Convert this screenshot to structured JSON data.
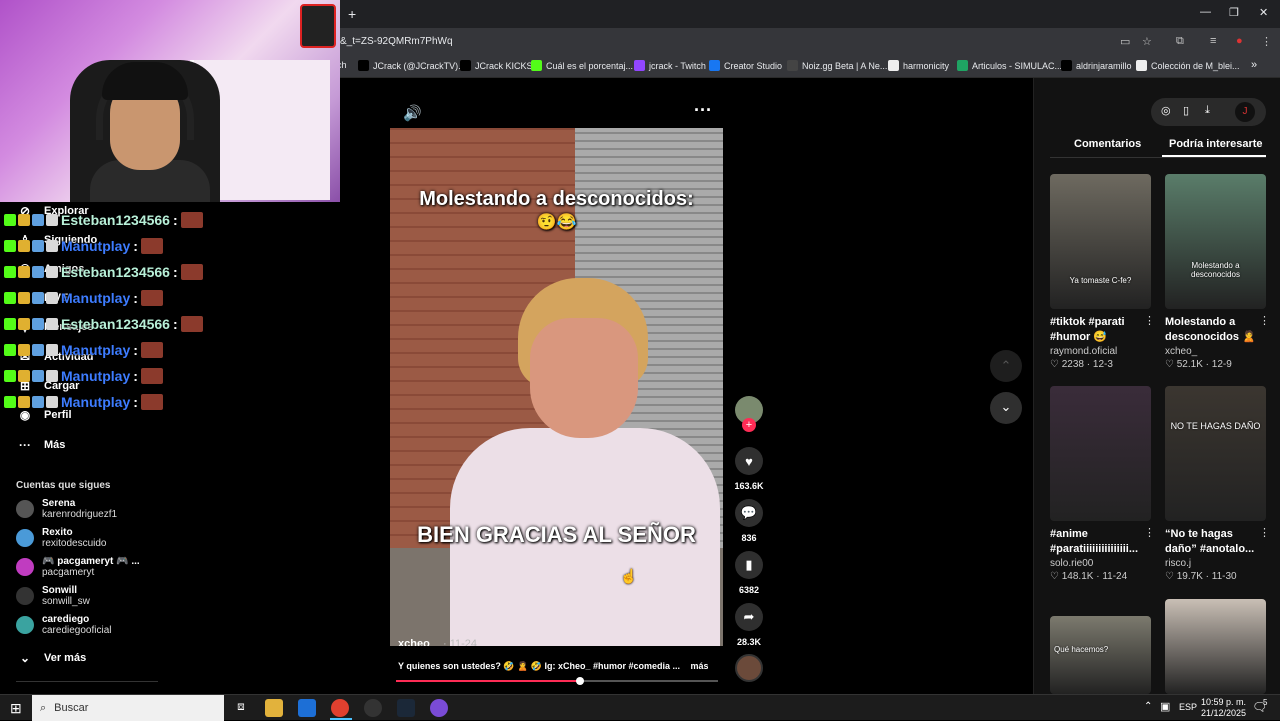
{
  "browser": {
    "url": "&_t=ZS-92QMRm7PhWq",
    "new_tab": "+",
    "bookmarks": [
      {
        "label": "ch"
      },
      {
        "label": "JCrack (@JCrackTV)...",
        "color": "#000"
      },
      {
        "label": "JCrack KICKS",
        "color": "#000"
      },
      {
        "label": "Cuál es el porcentaj...",
        "color": "#53fc18"
      },
      {
        "label": "jcrack - Twitch",
        "color": "#9146ff"
      },
      {
        "label": "Creator Studio",
        "color": "#1877f2"
      },
      {
        "label": "Noiz.gg Beta | A Ne...",
        "color": "#444"
      },
      {
        "label": "harmonicity",
        "color": "#eee"
      },
      {
        "label": "Articulos - SIMULAC...",
        "color": "#1fa463"
      },
      {
        "label": "aldrinjaramillo",
        "color": "#000"
      },
      {
        "label": "Colección de M_blei...",
        "color": "#eee"
      }
    ],
    "more_bookmarks": "»"
  },
  "nav": {
    "items": [
      {
        "label": "Explorar",
        "icon": "compass-icon"
      },
      {
        "label": "Siguiendo",
        "icon": "following-icon"
      },
      {
        "label": "Amigos",
        "icon": "friends-icon"
      },
      {
        "label": "LIVE",
        "icon": "live-icon"
      },
      {
        "label": "Mensajes",
        "icon": "messages-icon"
      },
      {
        "label": "Actividad",
        "icon": "activity-icon"
      },
      {
        "label": "Cargar",
        "icon": "upload-icon"
      },
      {
        "label": "Perfil",
        "icon": "profile-icon"
      },
      {
        "label": "Más",
        "icon": "more-icon"
      }
    ],
    "following_title": "Cuentas que sigues",
    "following": [
      {
        "name": "Serena",
        "handle": "karenrodriguezf1",
        "color": "#555"
      },
      {
        "name": "Rexito",
        "handle": "rexitodescuido",
        "color": "#4a9ad8"
      },
      {
        "name": "🎮 pacgameryt 🎮 ...",
        "handle": "pacgameryt",
        "color": "#c03cc0"
      },
      {
        "name": "Sonwill",
        "handle": "sonwill_sw",
        "color": "#333"
      },
      {
        "name": "carediego",
        "handle": "carediegooficial",
        "color": "#3aa3a0"
      }
    ],
    "see_more": "Ver más"
  },
  "chat": [
    {
      "user": "Esteban1234566",
      "color": "#b8f0d8",
      "sep": ":"
    },
    {
      "user": "Manutplay",
      "color": "#3d7cff",
      "sep": ":"
    },
    {
      "user": "Esteban1234566",
      "color": "#b8f0d8",
      "sep": ":"
    },
    {
      "user": "Manutplay",
      "color": "#3d7cff",
      "sep": ":"
    },
    {
      "user": "Esteban1234566",
      "color": "#b8f0d8",
      "sep": ":"
    },
    {
      "user": "Manutplay",
      "color": "#3d7cff",
      "sep": ":"
    },
    {
      "user": "Manutplay",
      "color": "#3d7cff",
      "sep": ":"
    },
    {
      "user": "Manutplay",
      "color": "#3d7cff",
      "sep": ":"
    }
  ],
  "video": {
    "overlay_title": "Molestando a desconocidos:",
    "overlay_emoji": "🤨😂",
    "caption_overlay": "BIEN GRACIAS AL SEÑOR",
    "author": "xcheo_",
    "date": "· 11-24",
    "description": "Y quienes son ustedes? 🤣 🙎 🤣 Ig: xCheo_ #humor #comedia ...",
    "more": "más",
    "progress": 0.57,
    "likes": "163.6K",
    "comments": "836",
    "saves": "6382",
    "shares": "28.3K"
  },
  "right": {
    "tabs": [
      "Comentarios",
      "Podría interesarte"
    ],
    "active_tab": 1,
    "cards": [
      {
        "title": "#tiktok #parati #humor 😅",
        "user": "raymond.oficial",
        "likes": "2238",
        "date": "12-3",
        "thumb_text": "Ya tomaste C-fe?",
        "bg": "#6e6a60"
      },
      {
        "title": "Molestando a desconocidos 🙎 ...",
        "user": "xcheo_",
        "likes": "52.1K",
        "date": "12-9",
        "thumb_text": "Molestando a desconocidos",
        "bg": "#5a7d6a"
      },
      {
        "title": "#anime #paratiiiiiiiiiiiiiii...",
        "user": "solo.rie00",
        "likes": "148.1K",
        "date": "11-24",
        "thumb_text": "",
        "bg": "#3a2c3a"
      },
      {
        "title": "“No te hagas daño” #anotalo...",
        "user": "risco.j",
        "likes": "19.7K",
        "date": "11-30",
        "thumb_text": "NO TE HAGAS DAÑO",
        "bg": "#3b3630"
      },
      {
        "title": "",
        "user": "",
        "likes": "",
        "date": "",
        "thumb_text": "Qué hacemos?",
        "bg": "#7c7a6e"
      },
      {
        "title": "",
        "user": "",
        "likes": "",
        "date": "",
        "thumb_text": "",
        "bg": "#c9bfb5"
      }
    ]
  },
  "taskbar": {
    "search_placeholder": "Buscar",
    "lang": "ESP",
    "time": "10:59 p. m.",
    "date": "21/12/2025",
    "notif": "5"
  }
}
